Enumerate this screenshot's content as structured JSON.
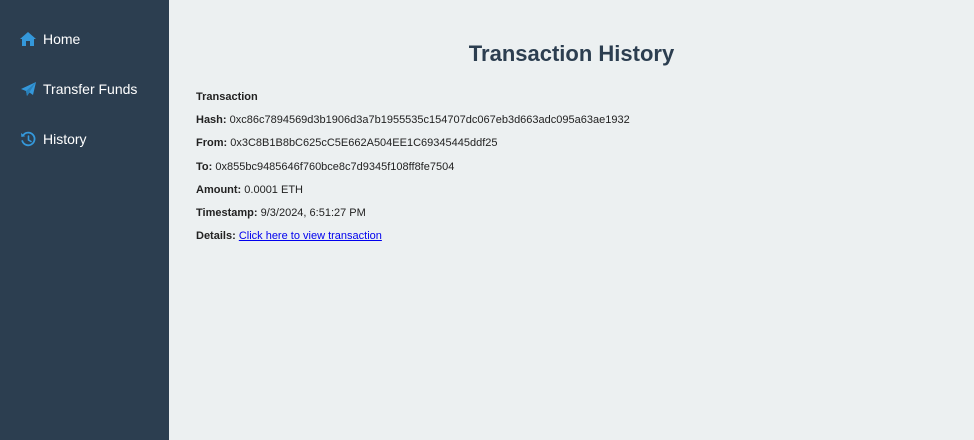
{
  "sidebar": {
    "items": [
      {
        "label": "Home",
        "icon": "home-icon"
      },
      {
        "label": "Transfer Funds",
        "icon": "paper-plane-icon"
      },
      {
        "label": "History",
        "icon": "history-icon"
      }
    ],
    "background": "#2c3e50",
    "icon_color": "#3498db"
  },
  "main": {
    "title": "Transaction History",
    "transaction": {
      "heading": "Transaction",
      "hash_label": "Hash:",
      "hash": "0xc86c7894569d3b1906d3a7b1955535c154707dc067eb3d663adc095a63ae1932",
      "from_label": "From:",
      "from": "0x3C8B1B8bC625cC5E662A504EE1C69345445ddf25",
      "to_label": "To:",
      "to": "0x855bc9485646f760bce8c7d9345f108ff8fe7504",
      "amount_label": "Amount:",
      "amount": "0.0001 ETH",
      "timestamp_label": "Timestamp:",
      "timestamp": "9/3/2024, 6:51:27 PM",
      "details_label": "Details:",
      "details_link": "Click here to view transaction"
    }
  }
}
